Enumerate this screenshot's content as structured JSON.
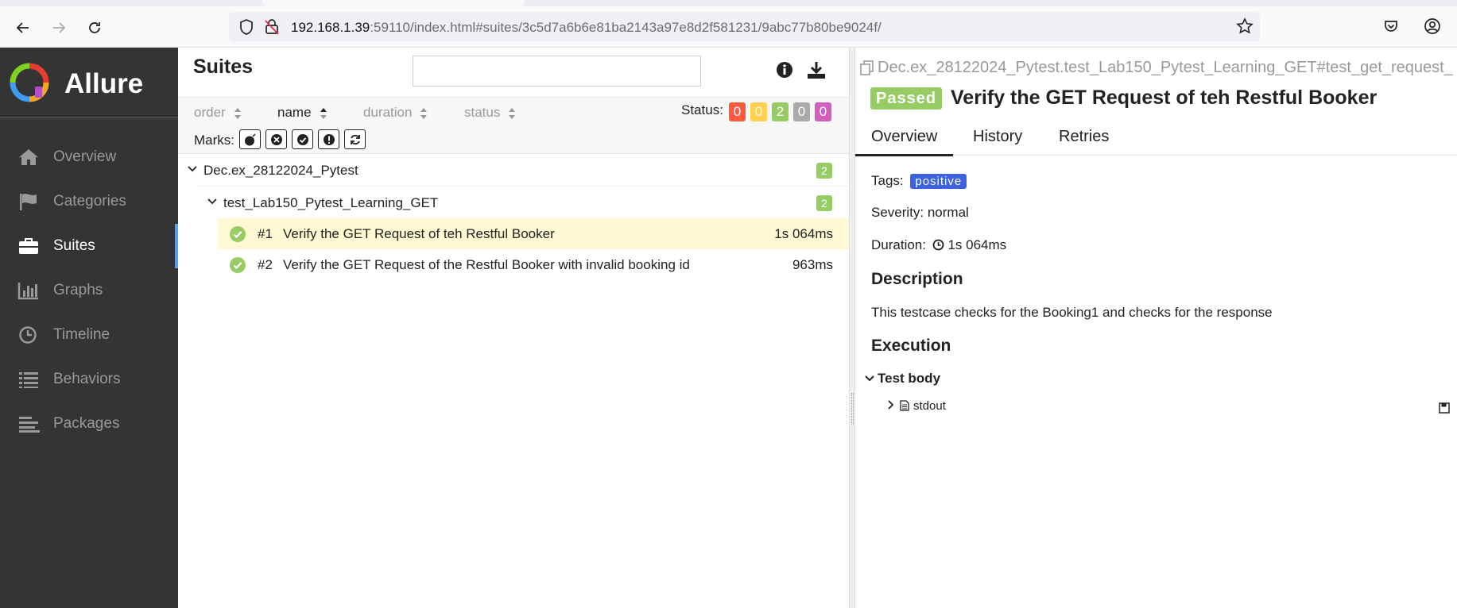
{
  "browser": {
    "url_host": "192.168.1.39",
    "url_rest": ":59110/index.html#suites/3c5d7a6b6e81ba2143a97e8d2f581231/9abc77b80be9024f/"
  },
  "sidebar": {
    "brand": "Allure",
    "items": [
      {
        "label": "Overview",
        "icon": "home-icon"
      },
      {
        "label": "Categories",
        "icon": "flag-icon"
      },
      {
        "label": "Suites",
        "icon": "briefcase-icon",
        "active": true
      },
      {
        "label": "Graphs",
        "icon": "bar-chart-icon"
      },
      {
        "label": "Timeline",
        "icon": "clock-icon"
      },
      {
        "label": "Behaviors",
        "icon": "list-icon"
      },
      {
        "label": "Packages",
        "icon": "align-left-icon"
      }
    ]
  },
  "suites": {
    "title": "Suites",
    "sort": {
      "order": "order",
      "name": "name",
      "duration": "duration",
      "status": "status"
    },
    "status_label": "Status:",
    "status_counts": [
      {
        "value": "0",
        "color": "#fd5a3e"
      },
      {
        "value": "0",
        "color": "#ffd050"
      },
      {
        "value": "2",
        "color": "#97cc64"
      },
      {
        "value": "0",
        "color": "#aaaaaa"
      },
      {
        "value": "0",
        "color": "#d35ebe"
      }
    ],
    "marks_label": "Marks:",
    "tree": {
      "suite": {
        "name": "Dec.ex_28122024_Pytest",
        "count": "2"
      },
      "subsuite": {
        "name": "test_Lab150_Pytest_Learning_GET",
        "count": "2"
      },
      "tests": [
        {
          "num": "#1",
          "name": "Verify the GET Request of teh Restful Booker",
          "duration": "1s 064ms"
        },
        {
          "num": "#2",
          "name": "Verify the GET Request of the Restful Booker with invalid booking id",
          "duration": "963ms"
        }
      ]
    }
  },
  "detail": {
    "breadcrumb": "Dec.ex_28122024_Pytest.test_Lab150_Pytest_Learning_GET#test_get_request_",
    "status": "Passed",
    "title": "Verify the GET Request of teh Restful Booker",
    "tabs": [
      "Overview",
      "History",
      "Retries"
    ],
    "tags_label": "Tags:",
    "tag": "positive",
    "severity": "Severity: normal",
    "duration_label": "Duration:",
    "duration": "1s 064ms",
    "description_heading": "Description",
    "description": "This testcase checks for the Booking1 and checks for the response",
    "execution_heading": "Execution",
    "test_body": "Test body",
    "attachment": "stdout"
  }
}
